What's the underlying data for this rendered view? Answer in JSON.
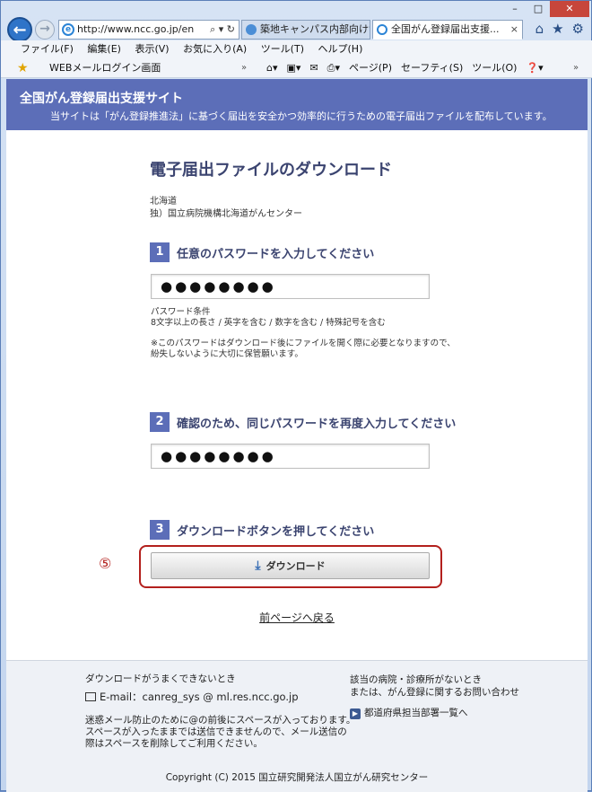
{
  "browser": {
    "url": "http://www.ncc.go.jp/en",
    "tabs": [
      {
        "label": "築地キャンパス内部向けサー..."
      },
      {
        "label": "全国がん登録届出支援..."
      }
    ],
    "menu": [
      "ファイル(F)",
      "編集(E)",
      "表示(V)",
      "お気に入り(A)",
      "ツール(T)",
      "ヘルプ(H)"
    ],
    "favorite": "WEBメールログイン画面",
    "toolbar": [
      "ページ(P)",
      "セーフティ(S)",
      "ツール(O)"
    ],
    "window_buttons": [
      "–",
      "□",
      "✕"
    ]
  },
  "banner": {
    "title": "全国がん登録届出支援サイト",
    "subtitle": "当サイトは「がん登録推進法」に基づく届出を安全かつ効率的に行うための電子届出ファイルを配布しています。"
  },
  "main": {
    "heading": "電子届出ファイルのダウンロード",
    "prefecture": "北海道",
    "hospital": "独）国立病院機構北海道がんセンター",
    "step1": {
      "num": "1",
      "title": "任意のパスワードを入力してください",
      "value": "●●●●●●●●"
    },
    "pw_rules_label": "パスワード条件",
    "pw_rules": "8文字以上の長さ / 英字を含む / 数字を含む / 特殊記号を含む",
    "note_line1": "※このパスワードはダウンロード後にファイルを開く際に必要となりますので、",
    "note_line2": "紛失しないように大切に保管願います。",
    "step2": {
      "num": "2",
      "title": "確認のため、同じパスワードを再度入力してください",
      "value": "●●●●●●●●"
    },
    "step3": {
      "num": "3",
      "title": "ダウンロードボタンを押してください"
    },
    "download_label": "ダウンロード",
    "marker": "⑤",
    "back_link": "前ページへ戻る"
  },
  "footer": {
    "left_title": "ダウンロードがうまくできないとき",
    "email": "E-mail：canreg_sys @ ml.res.ncc.go.jp",
    "left_note1": "迷惑メール防止のために@の前後にスペースが入っております。",
    "left_note2": "スペースが入ったままでは送信できませんので、メール送信の",
    "left_note3": "際はスペースを削除してご利用ください。",
    "right_line1": "該当の病院・診療所がないとき",
    "right_line2": "または、がん登録に関するお問い合わせ",
    "right_link": "都道府県担当部署一覧へ",
    "copyright": "Copyright (C) 2015 国立研究開発法人国立がん研究センター"
  }
}
